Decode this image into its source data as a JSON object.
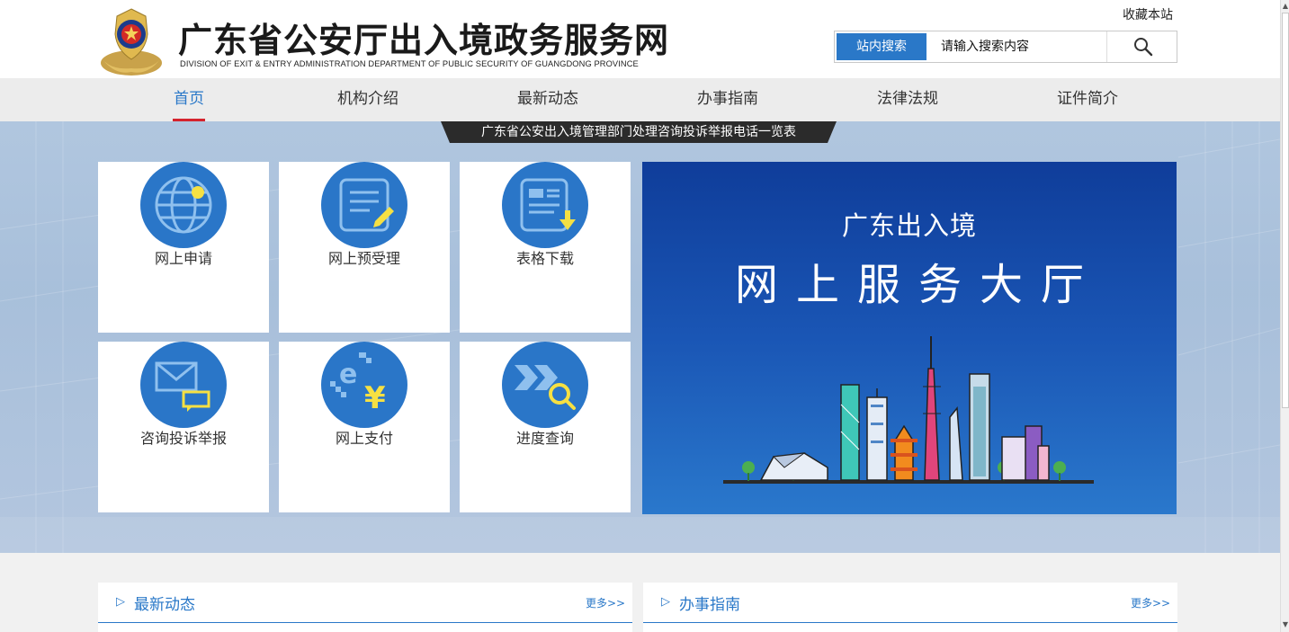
{
  "header": {
    "title": "广东省公安厅出入境政务服务网",
    "subtitle": "DIVISION OF EXIT & ENTRY ADMINISTRATION DEPARTMENT OF PUBLIC SECURITY OF GUANGDONG PROVINCE",
    "favorite_label": "收藏本站",
    "search": {
      "tab_label": "站内搜索",
      "placeholder": "请输入搜索内容",
      "button_icon": "search-icon"
    }
  },
  "nav": {
    "items": [
      {
        "label": "首页",
        "active": true
      },
      {
        "label": "机构介绍",
        "active": false
      },
      {
        "label": "最新动态",
        "active": false
      },
      {
        "label": "办事指南",
        "active": false
      },
      {
        "label": "法律法规",
        "active": false
      },
      {
        "label": "证件简介",
        "active": false
      }
    ]
  },
  "notice": {
    "text": "广东省公安出入境管理部门处理咨询投诉举报电话一览表"
  },
  "tiles": [
    {
      "label": "网上申请",
      "icon": "globe-icon"
    },
    {
      "label": "网上预受理",
      "icon": "document-edit-icon"
    },
    {
      "label": "表格下载",
      "icon": "form-download-icon"
    },
    {
      "label": "咨询投诉举报",
      "icon": "envelope-chat-icon"
    },
    {
      "label": "网上支付",
      "icon": "e-payment-yen-icon"
    },
    {
      "label": "进度查询",
      "icon": "progress-search-icon"
    }
  ],
  "banner": {
    "line1": "广东出入境",
    "line2": "网上服务大厅"
  },
  "panels": [
    {
      "title": "最新动态",
      "more": "更多>>"
    },
    {
      "title": "办事指南",
      "more": "更多>>"
    }
  ],
  "colors": {
    "primary": "#2a78c8",
    "active_underline": "#d5232d",
    "banner_dark": "#0f3d9a",
    "icon_accent": "#f5e043"
  }
}
